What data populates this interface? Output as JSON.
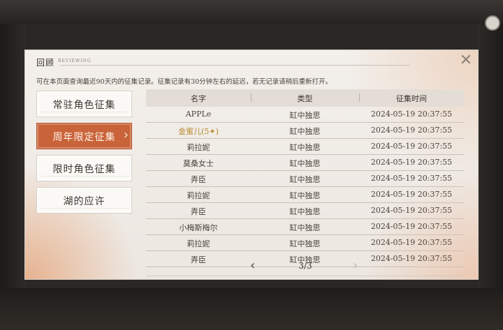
{
  "panel": {
    "title": "回顾",
    "title_sub": "REVIEWING",
    "notice": "可在本页面查询最近90天内的征集记录。征集记录有30分钟左右的延迟，若无记录请稍后重新打开。"
  },
  "sidebar": {
    "items": [
      {
        "label": "常驻角色征集"
      },
      {
        "label": "周年限定征集",
        "active": true
      },
      {
        "label": "限时角色征集"
      },
      {
        "label": "湖的应许"
      }
    ]
  },
  "table": {
    "headers": [
      "名字",
      "类型",
      "征集时间"
    ],
    "rows": [
      {
        "name": "APPLe",
        "type": "缸中独思",
        "time": "2024-05-19 20:37:55"
      },
      {
        "name": "金蜜儿(5✦)",
        "type": "缸中独思",
        "time": "2024-05-19 20:37:55",
        "highlight": "#b8892e"
      },
      {
        "name": "莉拉妮",
        "type": "缸中独思",
        "time": "2024-05-19 20:37:55"
      },
      {
        "name": "莫桑女士",
        "type": "缸中独思",
        "time": "2024-05-19 20:37:55"
      },
      {
        "name": "弄臣",
        "type": "缸中独思",
        "time": "2024-05-19 20:37:55"
      },
      {
        "name": "莉拉妮",
        "type": "缸中独思",
        "time": "2024-05-19 20:37:55"
      },
      {
        "name": "弄臣",
        "type": "缸中独思",
        "time": "2024-05-19 20:37:55"
      },
      {
        "name": "小梅斯梅尔",
        "type": "缸中独思",
        "time": "2024-05-19 20:37:55"
      },
      {
        "name": "莉拉妮",
        "type": "缸中独思",
        "time": "2024-05-19 20:37:55"
      },
      {
        "name": "弄臣",
        "type": "缸中独思",
        "time": "2024-05-19 20:37:55"
      }
    ]
  },
  "pager": {
    "text": "3/3",
    "prev_icon": "chevron-left-icon",
    "next_icon": "chevron-right-icon"
  },
  "colors": {
    "accent": "#c9643a",
    "highlight": "#b8892e"
  }
}
